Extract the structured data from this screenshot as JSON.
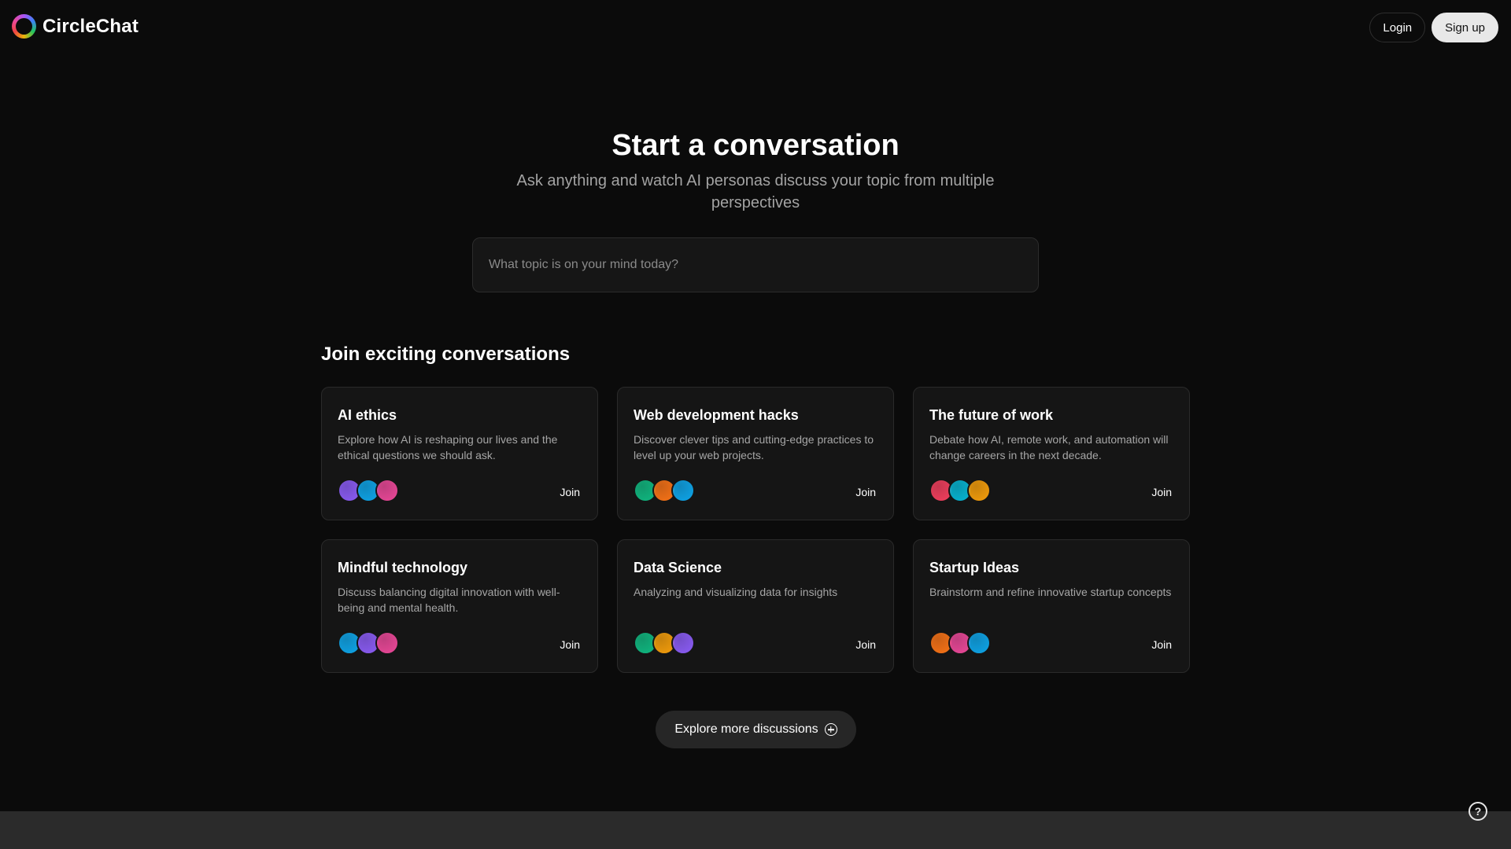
{
  "brand": {
    "name": "CircleChat",
    "logo_icon": "ring-logo-icon"
  },
  "auth": {
    "login_label": "Login",
    "signup_label": "Sign up"
  },
  "hero": {
    "title": "Start a conversation",
    "subtitle": "Ask anything and watch AI personas discuss your topic from multiple perspectives",
    "search_placeholder": "What topic is on your mind today?",
    "search_value": ""
  },
  "section": {
    "title": "Join exciting conversations"
  },
  "cards": [
    {
      "title": "AI ethics",
      "description": "Explore how AI is reshaping our lives and the ethical questions we should ask.",
      "join_label": "Join",
      "avatar_colors": [
        "#8b5cf6",
        "#0ea5e9",
        "#ec4899"
      ]
    },
    {
      "title": "Web development hacks",
      "description": "Discover clever tips and cutting-edge practices to level up your web projects.",
      "join_label": "Join",
      "avatar_colors": [
        "#10b981",
        "#f97316",
        "#0ea5e9"
      ]
    },
    {
      "title": "The future of work",
      "description": "Debate how AI, remote work, and automation will change careers in the next decade.",
      "join_label": "Join",
      "avatar_colors": [
        "#f43f5e",
        "#06b6d4",
        "#f59e0b"
      ]
    },
    {
      "title": "Mindful technology",
      "description": "Discuss balancing digital innovation with well-being and mental health.",
      "join_label": "Join",
      "avatar_colors": [
        "#0ea5e9",
        "#8b5cf6",
        "#ec4899"
      ]
    },
    {
      "title": "Data Science",
      "description": "Analyzing and visualizing data for insights",
      "join_label": "Join",
      "avatar_colors": [
        "#10b981",
        "#f59e0b",
        "#8b5cf6"
      ]
    },
    {
      "title": "Startup Ideas",
      "description": "Brainstorm and refine innovative startup concepts",
      "join_label": "Join",
      "avatar_colors": [
        "#f97316",
        "#ec4899",
        "#0ea5e9"
      ]
    }
  ],
  "explore": {
    "label": "Explore more discussions",
    "icon": "plus-circle-icon"
  },
  "help": {
    "label": "?",
    "icon": "help-circle-icon"
  },
  "colors": {
    "background": "#0b0b0b",
    "card": "#151515",
    "footer": "#2b2b2b",
    "muted_text": "#a3a3a3"
  }
}
